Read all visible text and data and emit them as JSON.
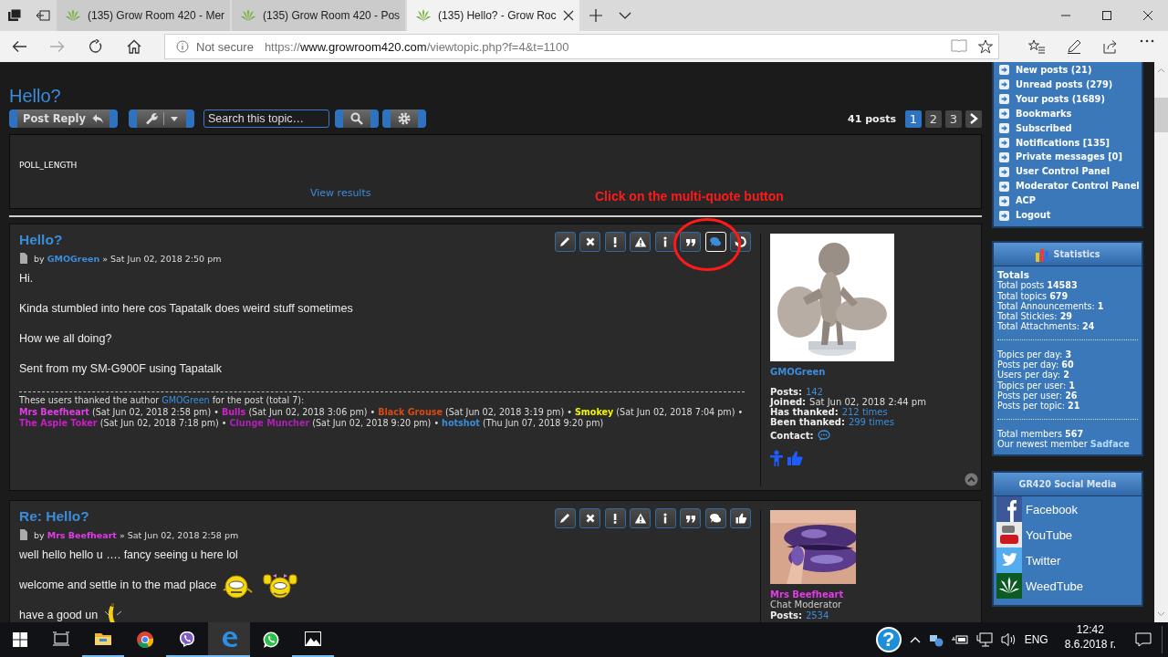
{
  "browser": {
    "tabs": [
      {
        "title": "(135) Grow Room 420 - Mer",
        "selected": false
      },
      {
        "title": "(135) Grow Room 420 - Pos",
        "selected": false
      },
      {
        "title": "(135) Hello? - Grow Roc",
        "selected": true
      }
    ],
    "address": {
      "security": "Not secure",
      "scheme": "https://",
      "host": "www.growroom420.com",
      "path": "/viewtopic.php?f=4&t=1100"
    }
  },
  "topic": {
    "title": "Hello?",
    "post_reply": "Post Reply",
    "search_placeholder": "Search this topic…",
    "post_count": "41 posts",
    "pages": [
      {
        "label": "1",
        "selected": true
      },
      {
        "label": "2",
        "selected": false
      },
      {
        "label": "3",
        "selected": false
      }
    ]
  },
  "poll": {
    "label": "POLL_LENGTH",
    "link": "View results"
  },
  "annotation": {
    "text": "Click on the multi-quote button"
  },
  "posts": [
    {
      "title": "Hello?",
      "byline": {
        "prefix": "by",
        "author": "GMOGreen",
        "color": "#3b8ddb",
        "date": "» Sat Jun 02, 2018 2:50 pm"
      },
      "buttons": [
        {
          "kind": "edit",
          "active": false
        },
        {
          "kind": "delete",
          "active": false
        },
        {
          "kind": "report",
          "active": false
        },
        {
          "kind": "warn",
          "active": false
        },
        {
          "kind": "info",
          "active": false
        },
        {
          "kind": "quote",
          "active": false
        },
        {
          "kind": "multiquote",
          "active": true
        },
        {
          "kind": "recycle",
          "active": false
        }
      ],
      "body": [
        {
          "text": "Hi."
        },
        {
          "text": "Kinda stumbled into here cos Tapatalk does weird stuff sometimes"
        },
        {
          "text": "How we all doing?"
        },
        {
          "text": "Sent from my SM-G900F using Tapatalk"
        }
      ],
      "thanks": {
        "intro": "These users thanked the author",
        "author": "GMOGreen",
        "outro": "for the post (total 7):",
        "entries": [
          {
            "name": "Mrs Beefheart",
            "color": "#e23be8",
            "date": "(Sat Jun 02, 2018 2:58 pm) •"
          },
          {
            "name": "Bulls",
            "color": "#d020d0",
            "date": "(Sat Jun 02, 2018 3:06 pm) •"
          },
          {
            "name": "Black Grouse",
            "color": "#d84a10",
            "date": "(Sat Jun 02, 2018 3:19 pm) •"
          },
          {
            "name": "Smokey",
            "color": "#f5f500",
            "date": "(Sat Jun 02, 2018 7:04 pm) •"
          },
          {
            "name": "The Aspie Toker",
            "color": "#c81ec8",
            "date": "(Sat Jun 02, 2018 7:18 pm) •"
          },
          {
            "name": "Clunge Muncher",
            "color": "#b01eb8",
            "date": "(Sat Jun 02, 2018 9:20 pm) •"
          },
          {
            "name": "hotshot",
            "color": "#3b8ddb",
            "date": "(Thu Jun 07, 2018 9:20 pm)"
          }
        ]
      },
      "profile": {
        "name": "GMOGreen",
        "color": "#3b8ddb",
        "fields": [
          {
            "kind": "link",
            "label": "Posts:",
            "value": "142"
          },
          {
            "kind": "text",
            "label": "Joined:",
            "value": "Sat Jun 02, 2018 2:44 pm"
          },
          {
            "kind": "link",
            "label": "Has thanked:",
            "value": "212 times"
          },
          {
            "kind": "link",
            "label": "Been thanked:",
            "value": "299 times"
          },
          {
            "kind": "contact",
            "label": "Contact:"
          }
        ],
        "rank_icons": [
          {
            "kind": "person"
          },
          {
            "kind": "like"
          }
        ]
      },
      "back_to_top": true
    },
    {
      "title": "Re: Hello?",
      "byline": {
        "prefix": "by",
        "author": "Mrs Beefheart",
        "color": "#e23be8",
        "date": "» Sat Jun 02, 2018 2:58 pm"
      },
      "buttons": [
        {
          "kind": "edit",
          "active": false
        },
        {
          "kind": "delete",
          "active": false
        },
        {
          "kind": "report",
          "active": false
        },
        {
          "kind": "warn",
          "active": false
        },
        {
          "kind": "info",
          "active": false
        },
        {
          "kind": "quote",
          "active": false
        },
        {
          "kind": "multiquote",
          "active": false
        },
        {
          "kind": "like",
          "active": false
        }
      ],
      "body": [
        {
          "text": "well hello hello u …. fancy seeing u here lol"
        },
        {
          "text": "welcome and settle in to the mad place",
          "smileys": [
            {
              "kind": "grin"
            },
            {
              "kind": "wave"
            }
          ]
        },
        {
          "text": "have a good un",
          "smileys": [
            {
              "kind": "banana"
            }
          ]
        }
      ],
      "profile": {
        "name": "Mrs Beefheart",
        "color": "#e23be8",
        "rank": "Chat Moderator",
        "fields": [
          {
            "kind": "link",
            "label": "Posts:",
            "value": "2534"
          }
        ]
      },
      "back_to_top": false
    }
  ],
  "sidebar": {
    "menu": [
      {
        "label": "New posts (21)"
      },
      {
        "label": "Unread posts (279)"
      },
      {
        "label": "Your posts (1689)"
      },
      {
        "label": "Bookmarks"
      },
      {
        "label": "Subscribed"
      },
      {
        "label": "Notifications [135]"
      },
      {
        "label": "Private messages [0]"
      },
      {
        "label": "User Control Panel"
      },
      {
        "label": "Moderator Control Panel"
      },
      {
        "label": "ACP"
      },
      {
        "label": "Logout"
      }
    ],
    "stats": {
      "title": "Statistics",
      "groups": [
        {
          "heading": "Totals",
          "rows": [
            {
              "label": "Total posts",
              "value": "14583"
            },
            {
              "label": "Total topics",
              "value": "679"
            },
            {
              "label": "Total Announcements:",
              "value": "1"
            },
            {
              "label": "Total Stickies:",
              "value": "29"
            },
            {
              "label": "Total Attachments:",
              "value": "24"
            }
          ]
        },
        {
          "rows": [
            {
              "label": "Topics per day:",
              "value": "3"
            },
            {
              "label": "Posts per day:",
              "value": "60"
            },
            {
              "label": "Users per day:",
              "value": "2"
            },
            {
              "label": "Topics per user:",
              "value": "1"
            },
            {
              "label": "Posts per user:",
              "value": "26"
            },
            {
              "label": "Posts per topic:",
              "value": "21"
            }
          ]
        },
        {
          "rows": [
            {
              "kind": "bold",
              "label": "Total members",
              "value": "567"
            },
            {
              "kind": "link",
              "label": "Our newest member",
              "value": "Sadface"
            }
          ]
        }
      ]
    },
    "social": {
      "title": "GR420 Social Media",
      "links": [
        {
          "label": "Facebook",
          "kind": "facebook"
        },
        {
          "label": "YouTube",
          "kind": "youtube"
        },
        {
          "label": "Twitter",
          "kind": "twitter"
        },
        {
          "label": "WeedTube",
          "kind": "weedtube"
        }
      ]
    }
  },
  "taskbar": {
    "apps": [
      {
        "kind": "task-view",
        "running": false,
        "active": false
      },
      {
        "kind": "explorer",
        "running": true,
        "active": false
      },
      {
        "kind": "chrome",
        "running": false,
        "active": false
      },
      {
        "kind": "viber",
        "running": true,
        "active": false
      },
      {
        "kind": "edge",
        "running": true,
        "active": true
      },
      {
        "kind": "whatsapp",
        "running": false,
        "active": false
      },
      {
        "kind": "photos",
        "running": true,
        "active": false
      }
    ],
    "help": "?",
    "language": "ENG",
    "time": "12:42",
    "date": "8.6.2018 г."
  }
}
